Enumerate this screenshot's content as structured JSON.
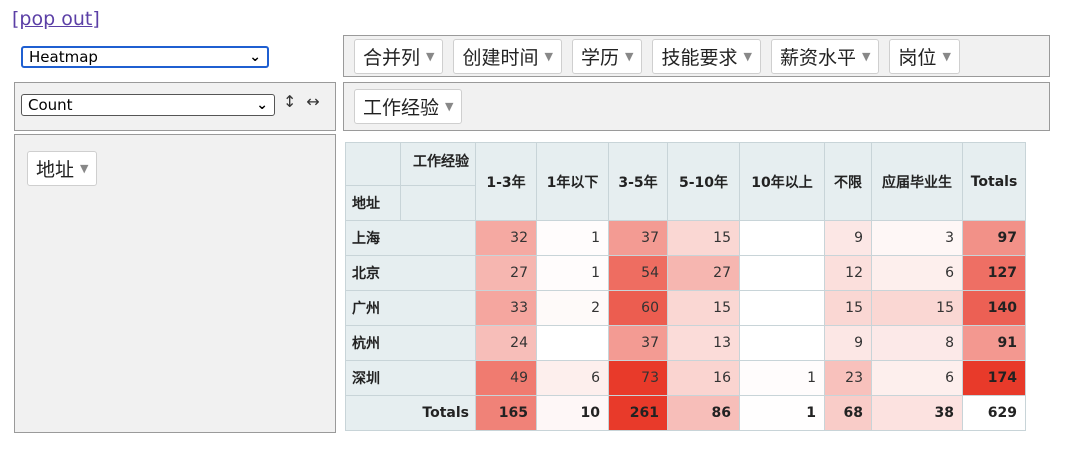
{
  "popout_label": "[pop out]",
  "renderer_select": {
    "value": "Heatmap"
  },
  "aggregator_select": {
    "value": "Count"
  },
  "icons": {
    "sort_rows": "↕",
    "sort_cols": "↔"
  },
  "unused_attrs": [
    "合并列",
    "创建时间",
    "学历",
    "技能要求",
    "薪资水平",
    "岗位"
  ],
  "col_attrs": [
    "工作经验"
  ],
  "row_attrs": [
    "地址"
  ],
  "table": {
    "col_attr_label": "工作经验",
    "row_attr_label": "地址",
    "columns": [
      "1-3年",
      "1年以下",
      "3-5年",
      "5-10年",
      "10年以上",
      "不限",
      "应届毕业生"
    ],
    "totals_label": "Totals",
    "rows": [
      {
        "label": "上海",
        "cells": [
          "32",
          "1",
          "37",
          "15",
          "",
          "9",
          "3"
        ],
        "total": "97"
      },
      {
        "label": "北京",
        "cells": [
          "27",
          "1",
          "54",
          "27",
          "",
          "12",
          "6"
        ],
        "total": "127"
      },
      {
        "label": "广州",
        "cells": [
          "33",
          "2",
          "60",
          "15",
          "",
          "15",
          "15"
        ],
        "total": "140"
      },
      {
        "label": "杭州",
        "cells": [
          "24",
          "",
          "37",
          "13",
          "",
          "9",
          "8"
        ],
        "total": "91"
      },
      {
        "label": "深圳",
        "cells": [
          "49",
          "6",
          "73",
          "16",
          "1",
          "23",
          "6"
        ],
        "total": "174"
      }
    ],
    "col_totals": [
      "165",
      "10",
      "261",
      "86",
      "1",
      "68",
      "38"
    ],
    "grand_total": "629"
  }
}
